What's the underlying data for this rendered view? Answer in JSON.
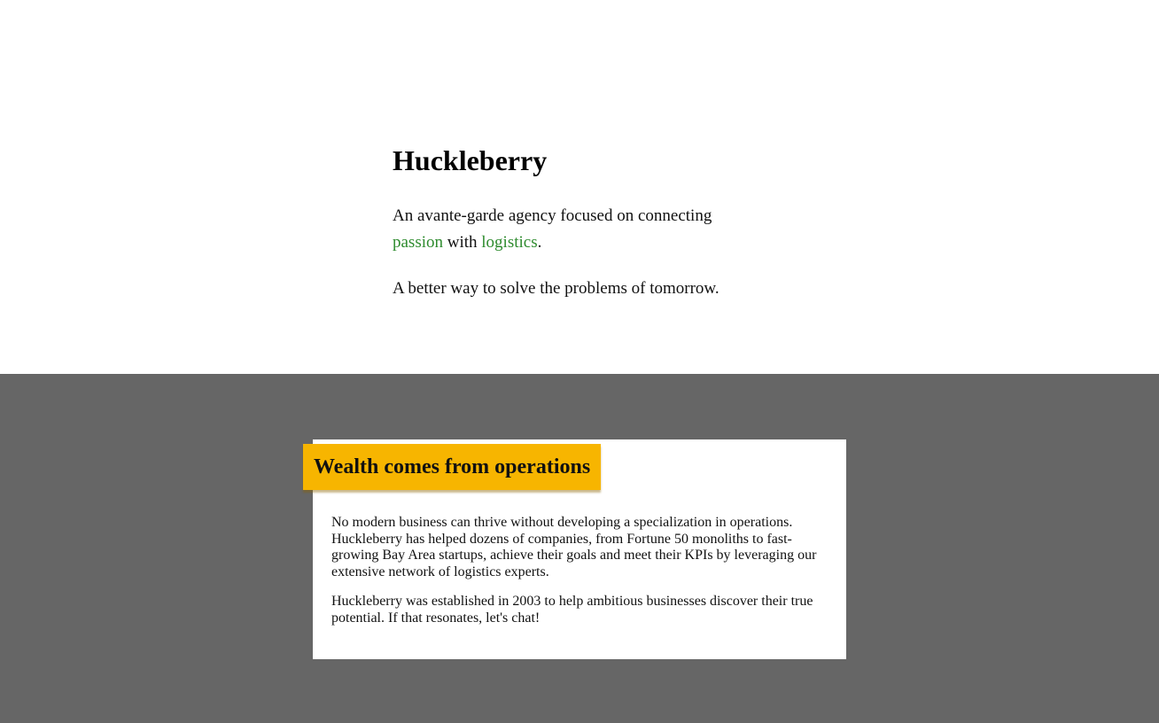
{
  "hero": {
    "title": "Huckleberry",
    "tagline_start": "An avante-garde agency focused on connecting ",
    "tagline_word1": "passion",
    "tagline_mid": " with ",
    "tagline_word2": "logistics",
    "tagline_end": ".",
    "subtitle": "A better way to solve the problems of tomorrow.",
    "accent_color": "#2e8b2e"
  },
  "section": {
    "banner_title": "Wealth comes from operations",
    "banner_color": "#f7b500",
    "background_color": "#666666",
    "paragraphs": [
      "No modern business can thrive without developing a specialization in operations. Huckleberry has helped dozens of companies, from Fortune 50 monoliths to fast-growing Bay Area startups, achieve their goals and meet their KPIs by leveraging our extensive network of logistics experts.",
      "Huckleberry was established in 2003 to help ambitious businesses discover their true potential. If that resonates, let's chat!"
    ]
  }
}
